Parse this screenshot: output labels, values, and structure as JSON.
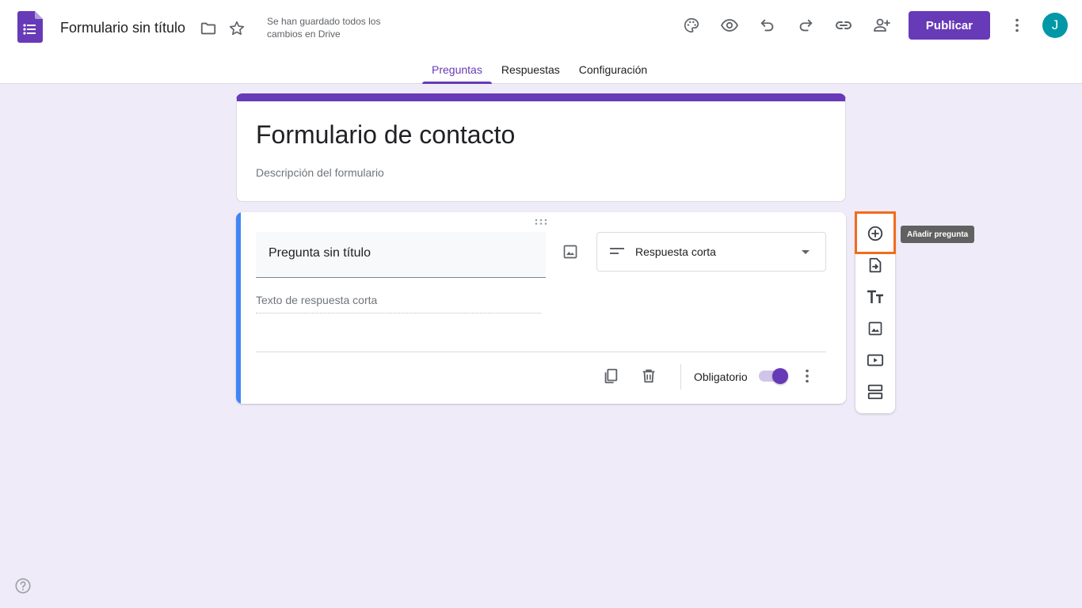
{
  "header": {
    "doc_title": "Formulario sin título",
    "save_status": "Se han guardado todos los cambios en Drive",
    "publish_label": "Publicar",
    "avatar_initial": "J"
  },
  "tabs": [
    {
      "label": "Preguntas",
      "active": true
    },
    {
      "label": "Respuestas",
      "active": false
    },
    {
      "label": "Configuración",
      "active": false
    }
  ],
  "form": {
    "title": "Formulario de contacto",
    "description": "Descripción del formulario"
  },
  "question": {
    "title": "Pregunta sin título",
    "type_label": "Respuesta corta",
    "answer_hint": "Texto de respuesta corta",
    "required_label": "Obligatorio",
    "required": true
  },
  "side_toolbar": {
    "tooltip": "Añadir pregunta",
    "items": [
      "add-question-icon",
      "import-questions-icon",
      "add-title-icon",
      "add-image-icon",
      "add-video-icon",
      "add-section-icon"
    ]
  },
  "colors": {
    "brand": "#673ab7",
    "background": "#f0ebf8",
    "question_accent": "#4285f4",
    "highlight": "#f26b1d",
    "avatar": "#0097a7"
  }
}
